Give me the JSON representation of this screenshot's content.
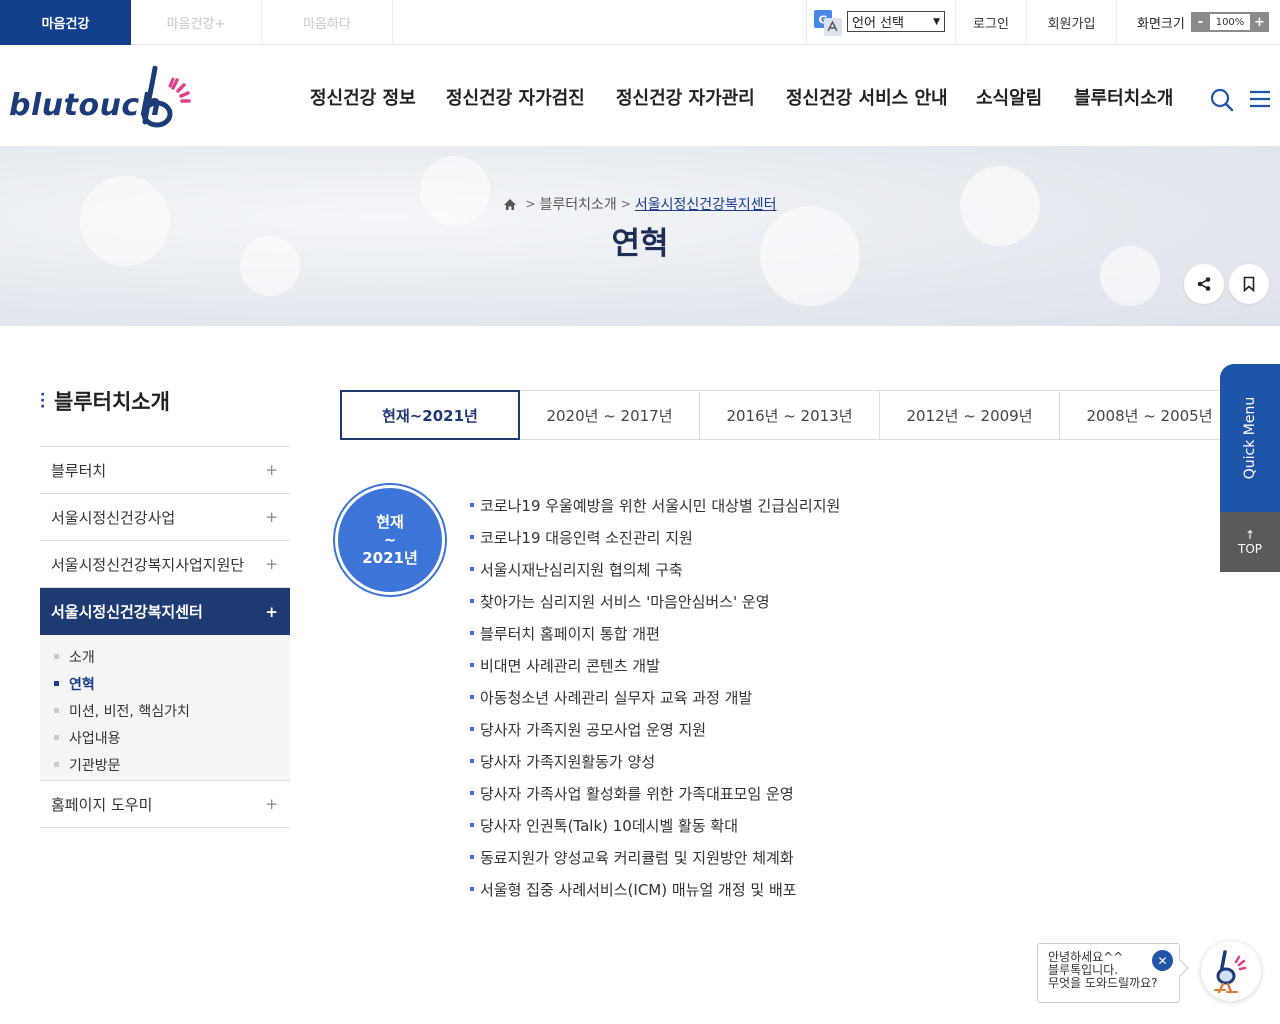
{
  "top_bar": {
    "site_tabs": [
      "마음건강",
      "마음건강+",
      "마음하다"
    ],
    "language_select": "언어 선택",
    "login": "로그인",
    "signup": "회원가입",
    "zoom_label": "화면크기",
    "zoom_minus": "-",
    "zoom_value": "100%",
    "zoom_plus": "+"
  },
  "header": {
    "logo_text": "blutouch",
    "nav": [
      "정신건강 정보",
      "정신건강 자가검진",
      "정신건강 자가관리",
      "정신건강 서비스 안내",
      "소식알림",
      "블루터치소개"
    ],
    "icons": {
      "search": "search-icon",
      "menu": "hamburger-menu-icon"
    }
  },
  "visual": {
    "breadcrumb": [
      "블루터치소개",
      "서울시정신건강복지센터"
    ],
    "title": "연혁",
    "share_icon": "share-icon",
    "bookmark_icon": "bookmark-icon"
  },
  "sidebar": {
    "title": "블루터치소개",
    "items": [
      {
        "label": "블루터치",
        "toggle": "+"
      },
      {
        "label": "서울시정신건강사업",
        "toggle": "+"
      },
      {
        "label": "서울시정신건강복지사업지원단",
        "toggle": "+"
      },
      {
        "label": "서울시정신건강복지센터",
        "toggle": "+"
      }
    ],
    "sub_items": [
      "소개",
      "연혁",
      "미션, 비전, 핵심가치",
      "사업내용",
      "기관방문"
    ],
    "last_item": {
      "label": "홈페이지 도우미",
      "toggle": "+"
    }
  },
  "history_tabs": [
    "현재~2021년",
    "2020년 ~ 2017년",
    "2016년 ~ 2013년",
    "2012년 ~ 2009년",
    "2008년 ~ 2005년"
  ],
  "period": {
    "line1": "현재",
    "line2": "~",
    "line3": "2021년"
  },
  "events": [
    "코로나19 우울예방을 위한 서울시민 대상별 긴급심리지원",
    "코로나19 대응인력 소진관리 지원",
    "서울시재난심리지원 협의체 구축",
    "찾아가는 심리지원 서비스 '마음안심버스' 운영",
    "블루터치 홈페이지 통합 개편",
    "비대면 사례관리 콘텐츠 개발",
    "아동청소년 사례관리 실무자 교육 과정 개발",
    "당사자 가족지원 공모사업 운영 지원",
    "당사자 가족지원활동가 양성",
    "당사자 가족사업 활성화를 위한 가족대표모임 운영",
    "당사자 인권톡(Talk) 10데시벨 활동 확대",
    "동료지원가 양성교육 커리큘럼 및 지원방안 체계화",
    "서울형 집중 사례서비스(ICM) 매뉴얼 개정 및 배포"
  ],
  "quick_menu": {
    "label": "Quick Menu",
    "top_arrow": "↑",
    "top": "TOP"
  },
  "chatbot": {
    "line1": "안녕하세요^^",
    "line2": "블루톡입니다.",
    "line3": "무엇을 도와드릴까요?",
    "close": "✕"
  }
}
